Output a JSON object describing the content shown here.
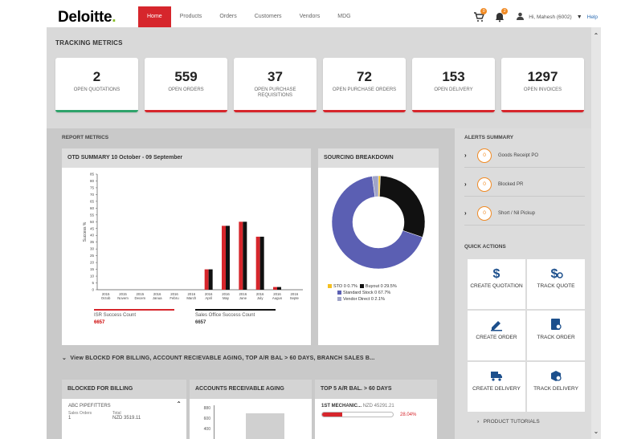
{
  "brand": {
    "name": "Deloitte",
    "dot": "."
  },
  "nav": [
    {
      "label": "Home",
      "active": true
    },
    {
      "label": "Products"
    },
    {
      "label": "Orders"
    },
    {
      "label": "Customers"
    },
    {
      "label": "Vendors"
    },
    {
      "label": "MDG"
    }
  ],
  "header": {
    "cart_count": "0",
    "notif_count": "2",
    "user": "Hi, Mahesh (6002)",
    "help": "Help"
  },
  "tracking": {
    "title": "TRACKING METRICS",
    "cards": [
      {
        "value": "2",
        "label": "OPEN QUOTATIONS",
        "accent": "green"
      },
      {
        "value": "559",
        "label": "OPEN ORDERS",
        "accent": "red"
      },
      {
        "value": "37",
        "label": "OPEN PURCHASE REQUISITIONS",
        "accent": "red"
      },
      {
        "value": "72",
        "label": "OPEN PURCHASE ORDERS",
        "accent": "red"
      },
      {
        "value": "153",
        "label": "OPEN DELIVERY",
        "accent": "red"
      },
      {
        "value": "1297",
        "label": "OPEN INVOICES",
        "accent": "red"
      }
    ]
  },
  "report": {
    "title": "REPORT METRICS"
  },
  "otd": {
    "title": "OTD SUMMARY 10 October - 09 September",
    "isr_label": "ISR Success Count",
    "isr_value": "6657",
    "sales_label": "Sales Office Success Count",
    "sales_value": "6657"
  },
  "sourcing": {
    "title": "SOURCING BREAKDOWN",
    "legend": [
      "STO 0 0.7%",
      "Buyout 0 29.5%",
      "Standard Stock 0 67.7%",
      "Vendor Direct 0 2.1%"
    ]
  },
  "alerts": {
    "title": "ALERTS SUMMARY",
    "items": [
      {
        "count": "0",
        "label": "Goods Receipt PO"
      },
      {
        "count": "0",
        "label": "Blocked PR"
      },
      {
        "count": "0",
        "label": "Short / Nil Pickup"
      }
    ]
  },
  "quick": {
    "title": "QUICK ACTIONS",
    "items": [
      {
        "label": "CREATE QUOTATION",
        "icon": "dollar-icon"
      },
      {
        "label": "TRACK QUOTE",
        "icon": "dollar-track-icon"
      },
      {
        "label": "CREATE ORDER",
        "icon": "pencil-icon"
      },
      {
        "label": "TRACK ORDER",
        "icon": "order-track-icon"
      },
      {
        "label": "CREATE DELIVERY",
        "icon": "truck-icon"
      },
      {
        "label": "TRACK DELIVERY",
        "icon": "box-track-icon"
      }
    ],
    "tutorials": "PRODUCT TUTORIALS"
  },
  "view_bar": "View BLOCKD FOR BILLING, ACCOUNT RECIEVABLE AGING, TOP A/R BAL > 60 DAYS, BRANCH SALES B...",
  "bottom": {
    "blocked": {
      "title": "BLOCKED FOR BILLING",
      "customer": "ABC PIPEFITTERS",
      "col1": "Sales Orders",
      "col2": "Total",
      "orders": "1",
      "total": "NZD 3519.11"
    },
    "aging": {
      "title": "ACCOUNTS RECEIVABLE AGING",
      "ticks": [
        "880",
        "600",
        "400"
      ]
    },
    "top5": {
      "title": "TOP 5 A/R BAL. > 60 DAYS",
      "name": "1ST MECHANIC...",
      "amount": "NZD 45291.21",
      "pct": "28.04%",
      "fill": 0.28
    }
  },
  "chart_data": [
    {
      "type": "bar",
      "title": "OTD SUMMARY 10 October - 09 September",
      "ylabel": "Success %",
      "ylim": [
        0,
        85
      ],
      "yticks": [
        "0",
        "5",
        "10",
        "15",
        "20",
        "25",
        "30",
        "35",
        "40",
        "45",
        "50",
        "55",
        "60",
        "65",
        "70",
        "75",
        "80",
        "85"
      ],
      "categories": [
        "2015 Octob",
        "2015 Novem",
        "2015 Decem",
        "2016 Janua",
        "2016 Febru",
        "2016 March",
        "2016 April",
        "2016 May",
        "2016 June",
        "2016 July",
        "2016 Augus",
        "2016 Septe"
      ],
      "series": [
        {
          "values": [
            0,
            0,
            0,
            0,
            0,
            0,
            15,
            47,
            50,
            39,
            2,
            0
          ],
          "color": "#d6262c"
        },
        {
          "values": [
            0,
            0,
            0,
            0,
            0,
            0,
            15,
            47,
            50,
            39,
            2,
            0
          ],
          "color": "#111111"
        }
      ]
    },
    {
      "type": "pie",
      "title": "SOURCING BREAKDOWN",
      "labels": [
        "STO",
        "Buyout",
        "Standard Stock",
        "Vendor Direct"
      ],
      "values": [
        0.7,
        29.5,
        67.7,
        2.1
      ],
      "colors": [
        "#f4c020",
        "#111111",
        "#5b5fb3",
        "#a0a4c8"
      ]
    }
  ]
}
